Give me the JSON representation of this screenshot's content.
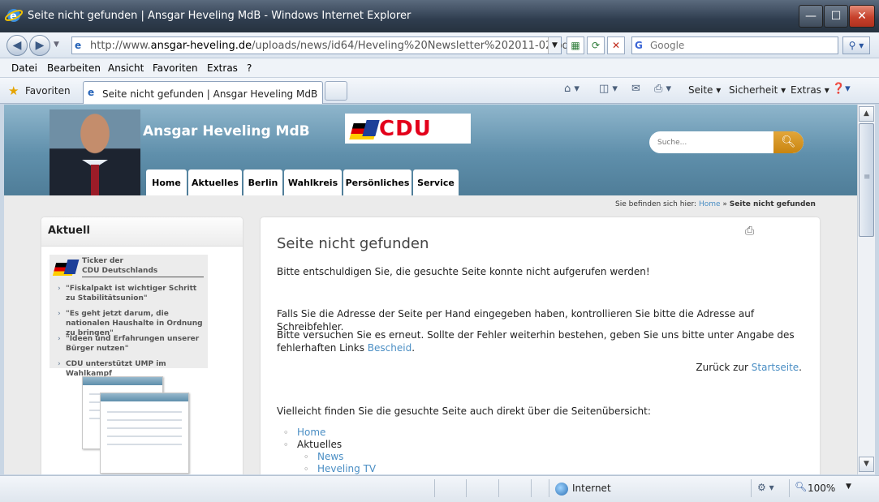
{
  "window": {
    "title": "Seite nicht gefunden | Ansgar Heveling MdB - Windows Internet Explorer",
    "min_glyph": "—",
    "max_glyph": "☐",
    "close_glyph": "✕"
  },
  "addressbar": {
    "url_prefix": "http://www.",
    "url_domain": "ansgar-heveling.de",
    "url_path": "/uploads/news/id64/Heveling%20Newsletter%202011-02.pdf",
    "search_placeholder": "Google"
  },
  "menu": [
    "Datei",
    "Bearbeiten",
    "Ansicht",
    "Favoriten",
    "Extras",
    "?"
  ],
  "favbar": {
    "favorites_label": "Favoriten",
    "tab_label": "Seite nicht gefunden | Ansgar Heveling MdB",
    "commands": [
      "Seite",
      "Sicherheit",
      "Extras"
    ]
  },
  "site": {
    "name": "Ansgar Heveling MdB",
    "logo_text": "CDU",
    "search_placeholder": "Suche...",
    "nav": [
      "Home",
      "Aktuelles",
      "Berlin",
      "Wahlkreis",
      "Persönliches",
      "Service"
    ]
  },
  "breadcrumb": {
    "prefix": "Sie befinden sich hier:",
    "home": "Home",
    "separator": "»",
    "current": "Seite nicht gefunden"
  },
  "sidebar": {
    "title": "Aktuell",
    "ticker_heading_line1": "Ticker der",
    "ticker_heading_line2": "CDU Deutschlands",
    "items": [
      "\"Fiskalpakt ist wichtiger Schritt zu Stabilitätsunion\"",
      "\"Es geht jetzt darum, die nationalen Haushalte in Ordnung zu bringen\"",
      "\"Ideen und Erfahrungen unserer Bürger nutzen\"",
      "CDU unterstützt UMP im Wahlkampf"
    ]
  },
  "content": {
    "title": "Seite nicht gefunden",
    "intro": "Bitte entschuldigen Sie, die gesuchte Seite konnte nicht aufgerufen werden!",
    "para1": "Falls Sie die Adresse der Seite per Hand eingegeben haben, kontrollieren Sie bitte die Adresse auf Schreibfehler.",
    "para2_text": "Bitte versuchen Sie es erneut. Sollte der Fehler weiterhin bestehen, geben Sie uns bitte unter Angabe des fehlerhaften Links ",
    "para2_link": "Bescheid",
    "para2_end": ".",
    "back_text": "Zurück zur ",
    "back_link": "Startseite",
    "back_end": ".",
    "sitemap_intro": "Vielleicht finden Sie die gesuchte Seite auch direkt über die Seitenübersicht:",
    "sitemap": {
      "home": "Home",
      "aktuelles": "Aktuelles",
      "sub": [
        "News",
        "Heveling TV"
      ]
    }
  },
  "statusbar": {
    "zone": "Internet",
    "zoom": "100%"
  },
  "colors": {
    "link": "#4a8ec4",
    "cdu_red": "#e3001b",
    "header_blue": "#5f8fab",
    "search_gold": "#c98510"
  }
}
